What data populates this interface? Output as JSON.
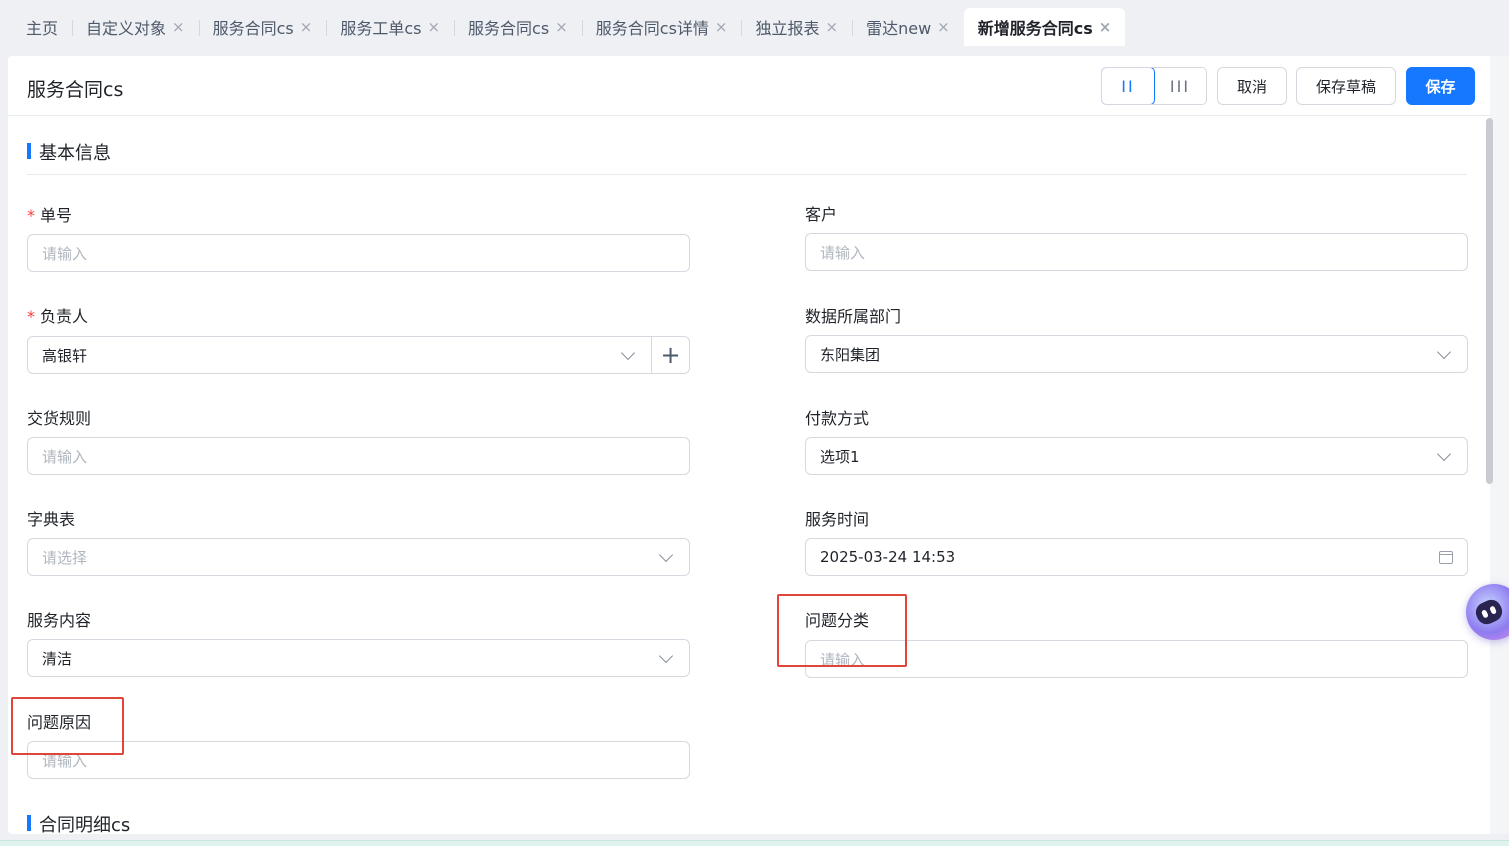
{
  "tabs": [
    {
      "label": "主页",
      "closable": false
    },
    {
      "label": "自定义对象",
      "closable": true
    },
    {
      "label": "服务合同cs",
      "closable": true
    },
    {
      "label": "服务工单cs",
      "closable": true
    },
    {
      "label": "服务合同cs",
      "closable": true
    },
    {
      "label": "服务合同cs详情",
      "closable": true
    },
    {
      "label": "独立报表",
      "closable": true
    },
    {
      "label": "雷达new",
      "closable": true
    },
    {
      "label": "新增服务合同cs",
      "closable": true,
      "active": true
    }
  ],
  "tab_close_glyph": "×",
  "header": {
    "title": "服务合同cs",
    "layout_two_col": "II",
    "layout_three_col": "III",
    "cancel_label": "取消",
    "save_draft_label": "保存草稿",
    "save_label": "保存"
  },
  "sections": {
    "basic_info": "基本信息",
    "contract_detail": "合同明细cs"
  },
  "required_mark": "*",
  "fields": {
    "order_no": {
      "label": "单号",
      "placeholder": "请输入"
    },
    "customer": {
      "label": "客户",
      "placeholder": "请输入"
    },
    "owner": {
      "label": "负责人",
      "value": "高银轩"
    },
    "department": {
      "label": "数据所属部门",
      "value": "东阳集团"
    },
    "delivery_rule": {
      "label": "交货规则",
      "placeholder": "请输入"
    },
    "payment_method": {
      "label": "付款方式",
      "value": "选项1"
    },
    "dictionary": {
      "label": "字典表",
      "placeholder": "请选择"
    },
    "service_time": {
      "label": "服务时间",
      "value": "2025-03-24 14:53"
    },
    "service_content": {
      "label": "服务内容",
      "value": "清洁"
    },
    "problem_category": {
      "label": "问题分类",
      "placeholder": "请输入"
    },
    "problem_cause": {
      "label": "问题原因",
      "placeholder": "请输入"
    }
  },
  "colors": {
    "primary": "#1677ff",
    "required": "#f53f3f",
    "annotation": "#e0453a"
  }
}
